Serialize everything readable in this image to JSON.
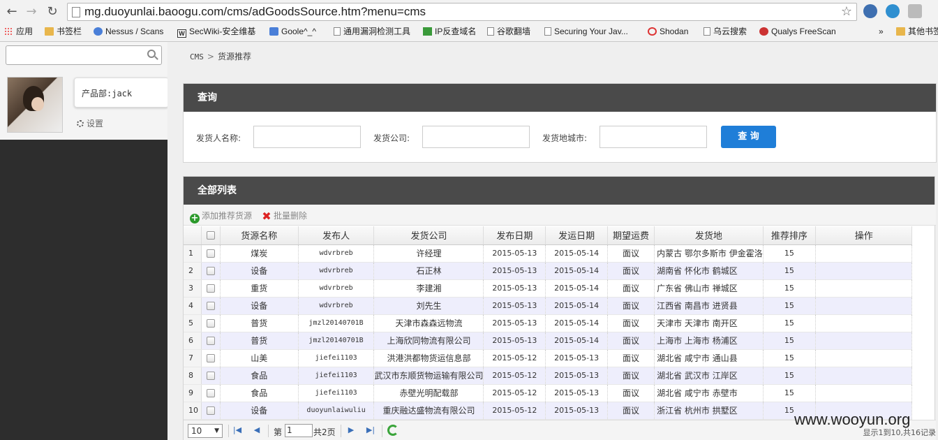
{
  "browser": {
    "url": "mg.duoyunlai.baoogu.com/cms/adGoodsSource.htm?menu=cms",
    "bookmarks": [
      "应用",
      "书签栏",
      "Nessus / Scans",
      "SecWiki-安全维基",
      "Goole^_^",
      "通用漏洞检测工具",
      "IP反查域名",
      "谷歌翻墙",
      "Securing Your Jav...",
      "Shodan",
      "乌云搜索",
      "Qualys FreeScan",
      "»",
      "其他书签"
    ]
  },
  "sidebar": {
    "user_name": "产品部:jack",
    "settings_label": "设置"
  },
  "breadcrumb": {
    "root": "CMS",
    "separator": ">",
    "current": "货源推荐"
  },
  "query": {
    "title": "查询",
    "shipper_name_label": "发货人名称:",
    "company_label": "发货公司:",
    "city_label": "发货地城市:",
    "button_label": "查 询"
  },
  "list": {
    "title": "全部列表",
    "add_label": "添加推荐货源",
    "batch_delete_label": "批量删除",
    "columns": [
      "货源名称",
      "发布人",
      "发货公司",
      "发布日期",
      "发运日期",
      "期望运费",
      "发货地",
      "推荐排序",
      "操作"
    ],
    "rows": [
      {
        "n": "1",
        "name": "煤炭",
        "publisher": "wdvrbreb",
        "company": "许经理",
        "pub_date": "2015-05-13",
        "ship_date": "2015-05-14",
        "fee": "面议",
        "origin": "内蒙古 鄂尔多斯市 伊金霍洛",
        "rank": "15"
      },
      {
        "n": "2",
        "name": "设备",
        "publisher": "wdvrbreb",
        "company": "石正林",
        "pub_date": "2015-05-13",
        "ship_date": "2015-05-14",
        "fee": "面议",
        "origin": "湖南省 怀化市 鹤城区",
        "rank": "15"
      },
      {
        "n": "3",
        "name": "重货",
        "publisher": "wdvrbreb",
        "company": "李建湘",
        "pub_date": "2015-05-13",
        "ship_date": "2015-05-14",
        "fee": "面议",
        "origin": "广东省 佛山市 禅城区",
        "rank": "15"
      },
      {
        "n": "4",
        "name": "设备",
        "publisher": "wdvrbreb",
        "company": "刘先生",
        "pub_date": "2015-05-13",
        "ship_date": "2015-05-14",
        "fee": "面议",
        "origin": "江西省 南昌市 进贤县",
        "rank": "15"
      },
      {
        "n": "5",
        "name": "普货",
        "publisher": "jmzl20140701B",
        "company": "天津市森森远物流",
        "pub_date": "2015-05-13",
        "ship_date": "2015-05-14",
        "fee": "面议",
        "origin": "天津市 天津市 南开区",
        "rank": "15"
      },
      {
        "n": "6",
        "name": "普货",
        "publisher": "jmzl20140701B",
        "company": "上海欣同物流有限公司",
        "pub_date": "2015-05-13",
        "ship_date": "2015-05-14",
        "fee": "面议",
        "origin": "上海市 上海市 杨浦区",
        "rank": "15"
      },
      {
        "n": "7",
        "name": "山美",
        "publisher": "jiefei1103",
        "company": "洪港洪都物货运信息部",
        "pub_date": "2015-05-12",
        "ship_date": "2015-05-13",
        "fee": "面议",
        "origin": "湖北省 咸宁市 通山县",
        "rank": "15"
      },
      {
        "n": "8",
        "name": "食品",
        "publisher": "jiefei1103",
        "company": "武汉市东顺货物运输有限公司",
        "pub_date": "2015-05-12",
        "ship_date": "2015-05-13",
        "fee": "面议",
        "origin": "湖北省 武汉市 江岸区",
        "rank": "15"
      },
      {
        "n": "9",
        "name": "食品",
        "publisher": "jiefei1103",
        "company": "赤壁光明配载部",
        "pub_date": "2015-05-12",
        "ship_date": "2015-05-13",
        "fee": "面议",
        "origin": "湖北省 咸宁市 赤壁市",
        "rank": "15"
      },
      {
        "n": "10",
        "name": "设备",
        "publisher": "duoyunlaiwuliu",
        "company": "重庆融达盛物流有限公司",
        "pub_date": "2015-05-12",
        "ship_date": "2015-05-13",
        "fee": "面议",
        "origin": "浙江省 杭州市 拱墅区",
        "rank": "15"
      }
    ]
  },
  "pager": {
    "page_size": "10",
    "page_prefix": "第",
    "page_value": "1",
    "page_suffix": "共2页",
    "info": "显示1到10,共16记录"
  },
  "watermark": "www.wooyun.org",
  "colors": {
    "header_bar": "#4a4a4a",
    "query_button": "#1f7ed8",
    "sidebar_dark": "#2d2d2d",
    "row_alt": "#eeeefc"
  }
}
